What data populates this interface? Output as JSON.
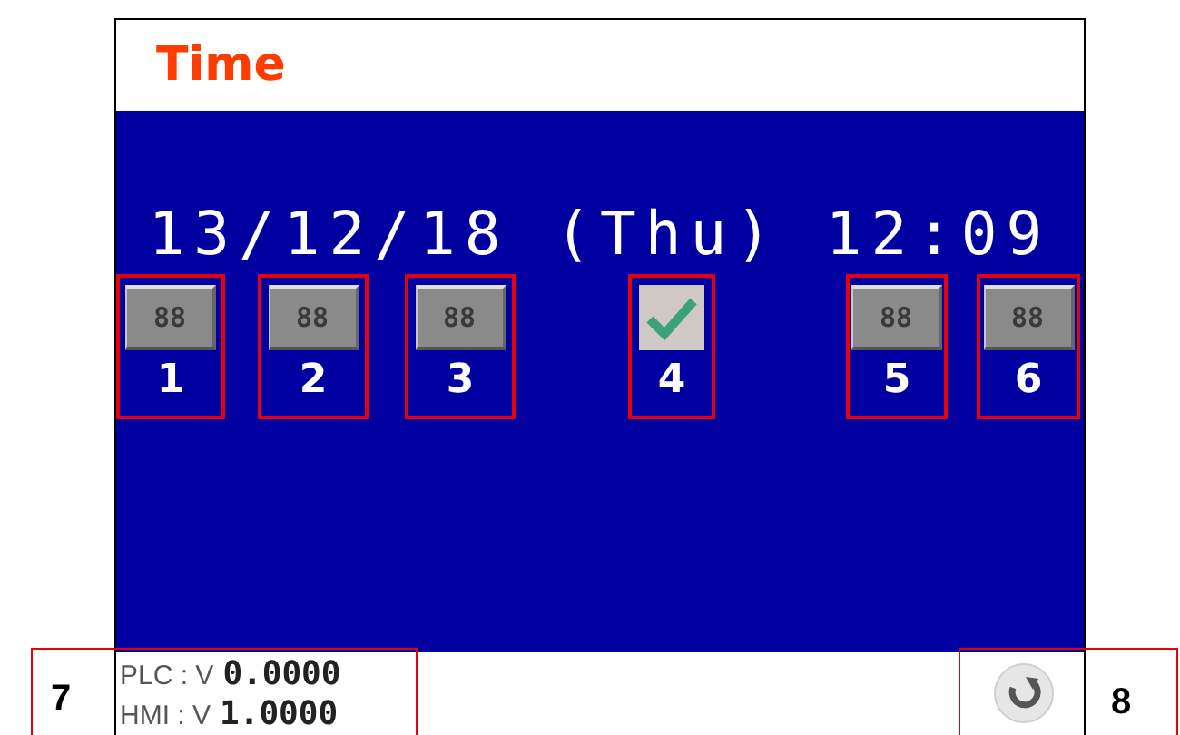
{
  "screen": {
    "title": "Time",
    "date_time": "13/12/18 (Thu) 12:09",
    "slots": [
      {
        "kind": "button",
        "face": "88",
        "number": "1"
      },
      {
        "kind": "button",
        "face": "88",
        "number": "2"
      },
      {
        "kind": "button",
        "face": "88",
        "number": "3"
      },
      {
        "kind": "check",
        "number": "4"
      },
      {
        "kind": "button",
        "face": "88",
        "number": "5"
      },
      {
        "kind": "button",
        "face": "88",
        "number": "6"
      }
    ]
  },
  "footer": {
    "versions": [
      {
        "label": "PLC : V",
        "value": "0.0000"
      },
      {
        "label": "HMI : V",
        "value": "1.0000"
      }
    ]
  },
  "callouts": [
    "7",
    "8"
  ]
}
